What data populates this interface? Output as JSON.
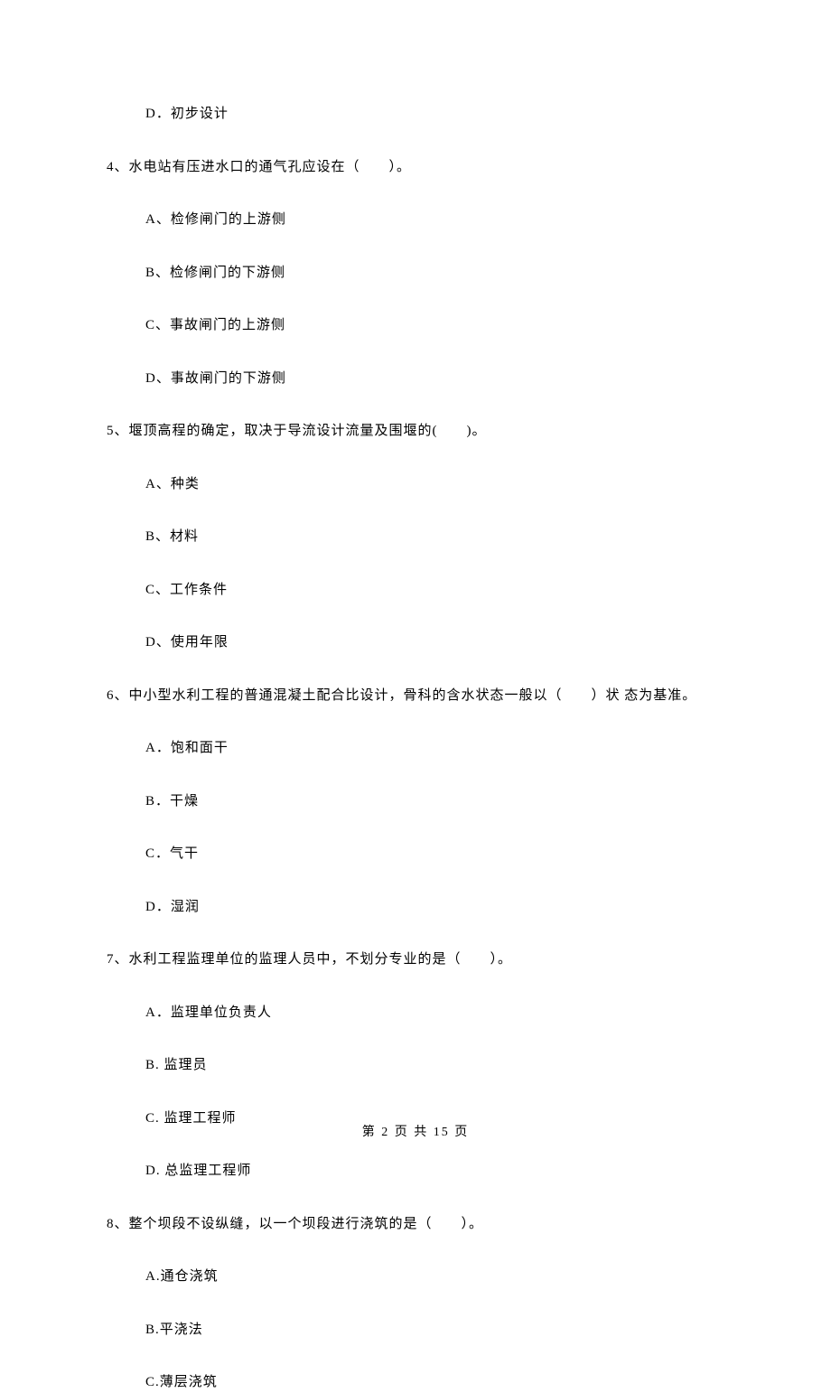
{
  "orphan_option": "D．初步设计",
  "questions": [
    {
      "stem": "4、水电站有压进水口的通气孔应设在（　　）。",
      "options": [
        "A、检修闸门的上游侧",
        "B、检修闸门的下游侧",
        "C、事故闸门的上游侧",
        "D、事故闸门的下游侧"
      ]
    },
    {
      "stem": "5、堰顶高程的确定，取决于导流设计流量及围堰的(　　)。",
      "options": [
        "A、种类",
        "B、材料",
        "C、工作条件",
        "D、使用年限"
      ]
    },
    {
      "stem": "6、中小型水利工程的普通混凝土配合比设计，骨科的含水状态一般以（　　）状 态为基准。",
      "options": [
        "A．饱和面干",
        "B．干燥",
        "C．气干",
        "D．湿润"
      ]
    },
    {
      "stem": "7、水利工程监理单位的监理人员中，不划分专业的是（　　）。",
      "options": [
        "A．监理单位负责人",
        "B. 监理员",
        "C. 监理工程师",
        "D. 总监理工程师"
      ]
    },
    {
      "stem": "8、整个坝段不设纵缝，以一个坝段进行浇筑的是（　　）。",
      "options": [
        "A.通仓浇筑",
        "B.平浇法",
        "C.薄层浇筑"
      ]
    }
  ],
  "footer": "第 2 页 共 15 页"
}
